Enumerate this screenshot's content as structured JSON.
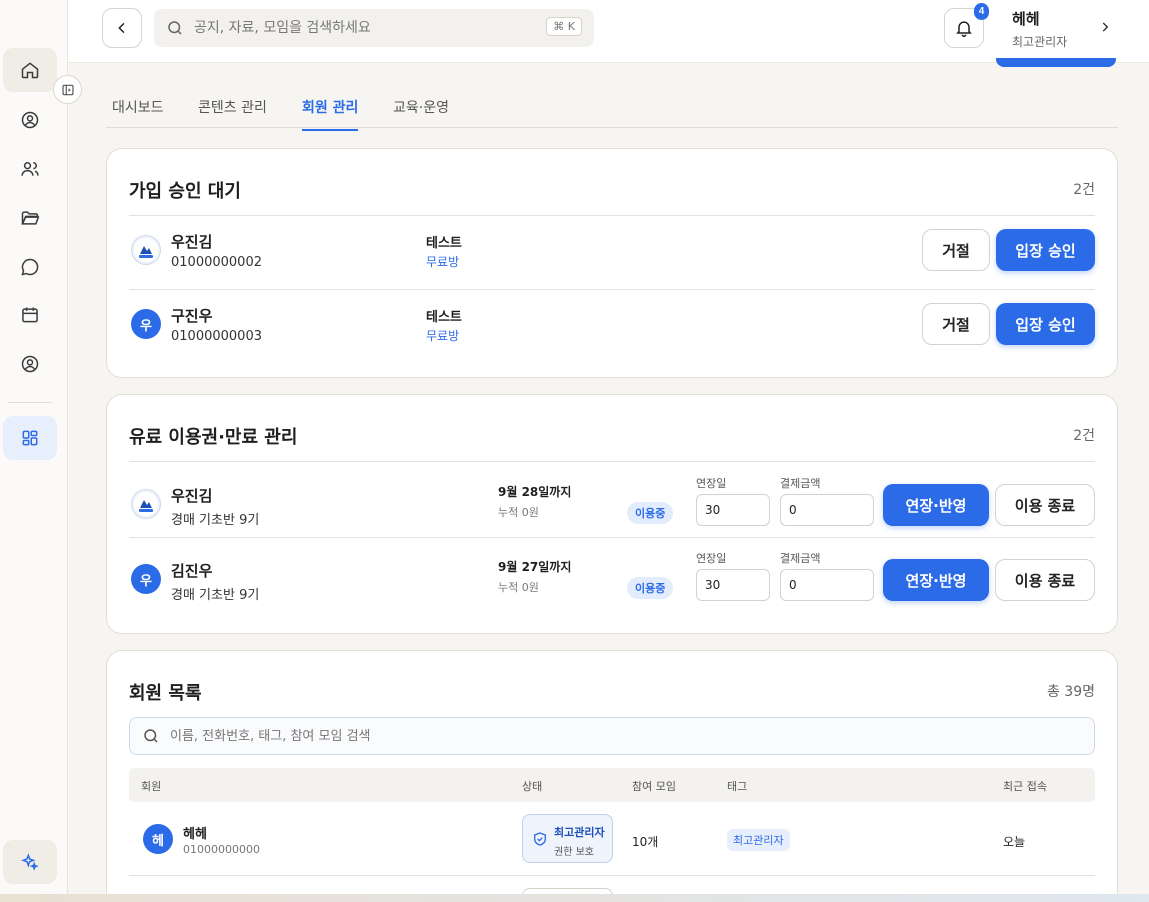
{
  "topbar": {
    "search_placeholder": "공지, 자료, 모임을 검색하세요",
    "shortcut": "⌘ K",
    "notification_count": "4",
    "user_name": "헤헤",
    "user_role": "최고관리자"
  },
  "tabs": [
    "대시보드",
    "콘텐츠 관리",
    "회원 관리",
    "교육·운영"
  ],
  "pending": {
    "title": "가입 승인 대기",
    "count": "2건",
    "reject_label": "거절",
    "approve_label": "입장 승인",
    "items": [
      {
        "name": "우진김",
        "phone": "01000000002",
        "room": "테스트",
        "room_type": "무료방",
        "avatar": "logo"
      },
      {
        "name": "구진우",
        "phone": "01000000003",
        "room": "테스트",
        "room_type": "무료방",
        "avatar": "우"
      }
    ]
  },
  "paid": {
    "title": "유료 이용권·만료 관리",
    "count": "2건",
    "extend_days_label": "연장일",
    "payment_label": "결제금액",
    "extend_btn": "연장·반영",
    "end_btn": "이용 종료",
    "items": [
      {
        "name": "우진김",
        "course": "경매 기초반 9기",
        "until": "9월 28일까지",
        "cumulative": "누적 0원",
        "status": "이용중",
        "days": "30",
        "amount": "0",
        "avatar": "logo"
      },
      {
        "name": "김진우",
        "course": "경매 기초반 9기",
        "until": "9월 27일까지",
        "cumulative": "누적 0원",
        "status": "이용중",
        "days": "30",
        "amount": "0",
        "avatar": "우"
      }
    ]
  },
  "members": {
    "title": "회원 목록",
    "count": "총 39명",
    "search_placeholder": "이름, 전화번호, 태그, 참여 모임 검색",
    "columns": [
      "회원",
      "상태",
      "참여 모임",
      "태그",
      "최근 접속"
    ],
    "rows": [
      {
        "avatar": "헤",
        "name": "헤헤",
        "phone": "01000000000",
        "status_title": "최고관리자",
        "status_sub": "권한 보호",
        "groups": "10개",
        "tag": "최고관리자",
        "last_seen": "오늘"
      }
    ]
  }
}
